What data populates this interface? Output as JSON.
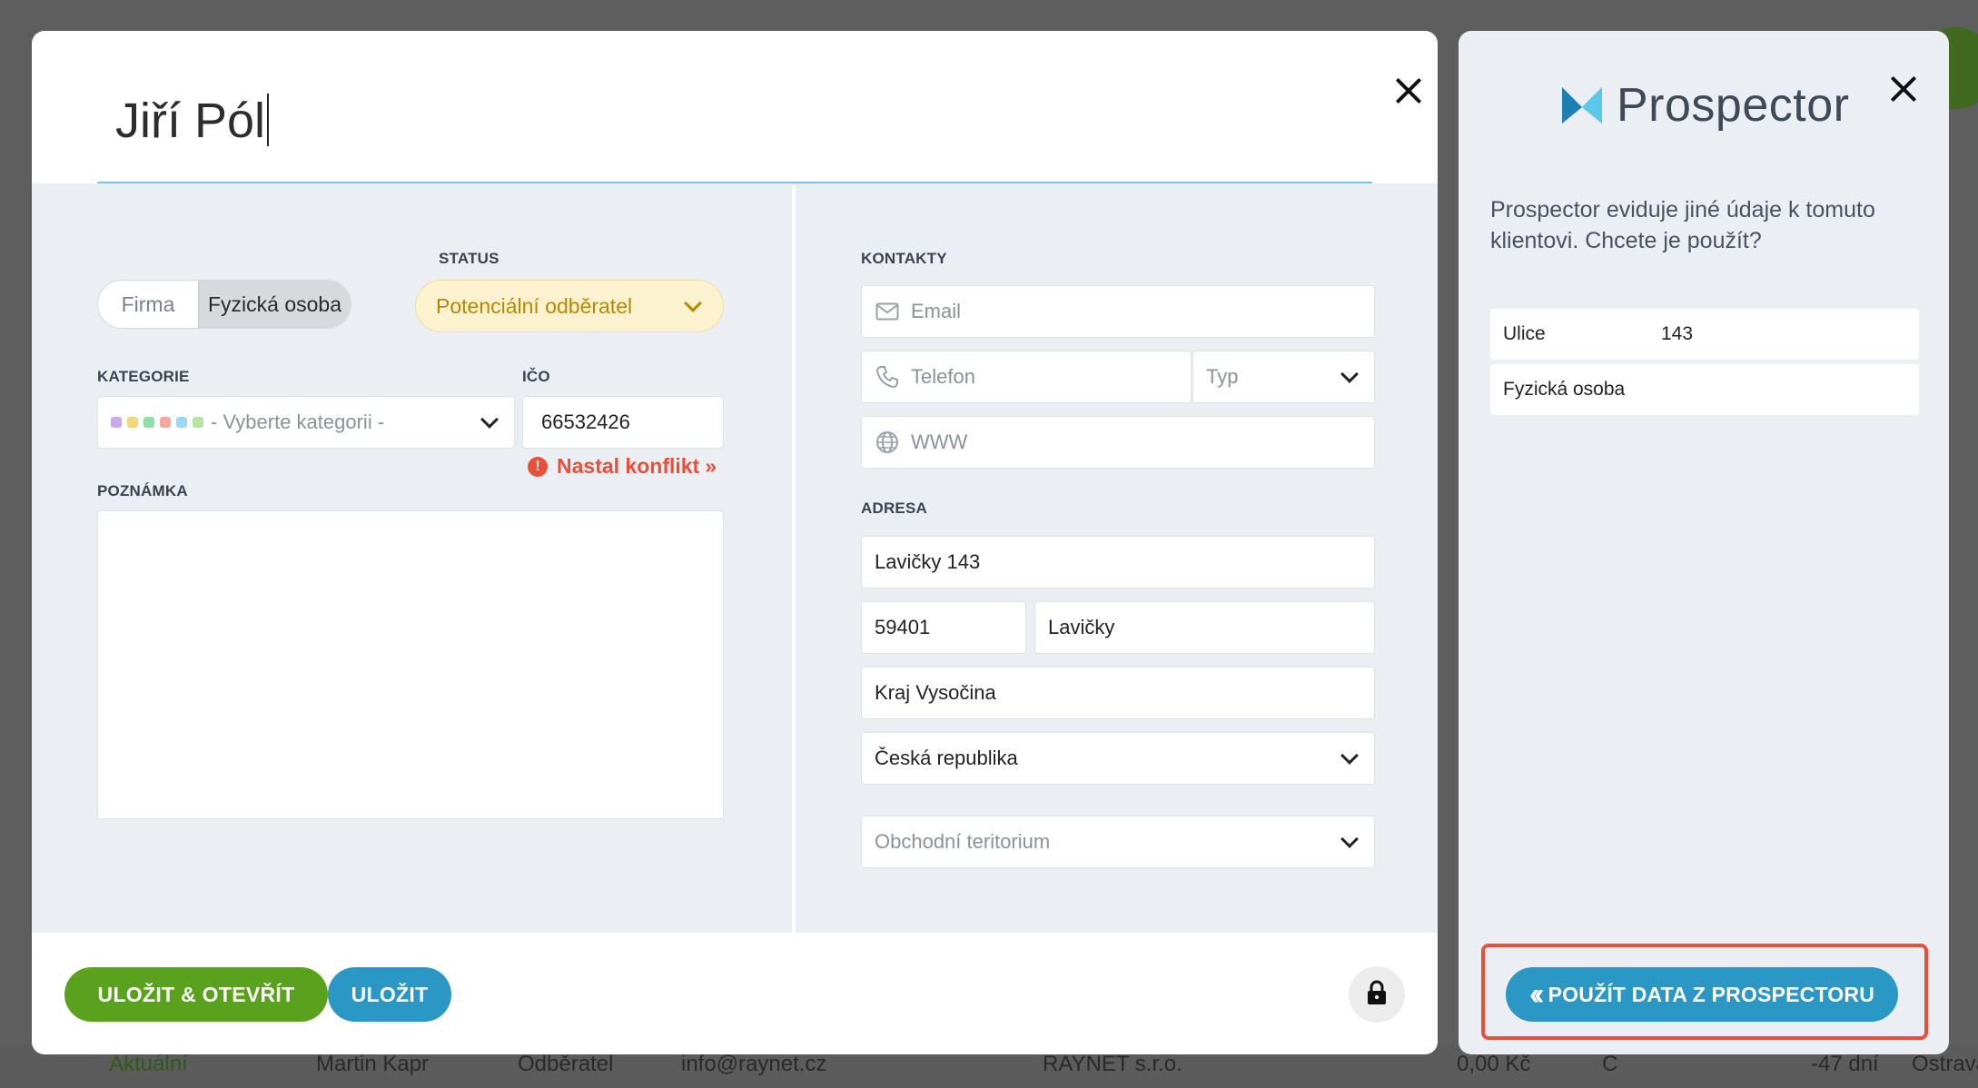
{
  "background": {
    "bottom_row": [
      "Aktuální",
      "Martin Kapr",
      "Odběratel",
      "info@raynet.cz",
      "RAYNET s.r.o.",
      "0,00 Kč",
      "C",
      "-47 dní",
      "Ostrava"
    ]
  },
  "modal": {
    "title": "Jiří Pól",
    "type_toggle": {
      "option_company": "Firma",
      "option_person": "Fyzická osoba",
      "selected": "Fyzická osoba"
    },
    "status": {
      "label": "STATUS",
      "value": "Potenciální odběratel"
    },
    "category": {
      "label": "KATEGORIE",
      "placeholder": "- Vyberte kategorii -",
      "dot_colors": [
        "#c9a8f0",
        "#f2d67a",
        "#8ee0a8",
        "#f5a7a0",
        "#9fd6f2",
        "#b7e4a0"
      ]
    },
    "ico": {
      "label": "IČO",
      "value": "66532426"
    },
    "conflict": {
      "text": "Nastal konflikt",
      "suffix": "»"
    },
    "note": {
      "label": "POZNÁMKA",
      "value": ""
    },
    "contacts": {
      "label": "KONTAKTY",
      "email_placeholder": "Email",
      "phone_placeholder": "Telefon",
      "phone_type_placeholder": "Typ",
      "www_placeholder": "WWW"
    },
    "address": {
      "label": "ADRESA",
      "street": "Lavičky 143",
      "zip": "59401",
      "city": "Lavičky",
      "region": "Kraj Vysočina",
      "country": "Česká republika",
      "territory_placeholder": "Obchodní teritorium"
    },
    "footer": {
      "save_open": "ULOŽIT & OTEVŘÍT",
      "save": "ULOŽIT"
    }
  },
  "prospector": {
    "brand": "Prospector",
    "message": "Prospector eviduje jiné údaje k tomuto klientovi. Chcete je použít?",
    "rows": [
      {
        "key": "Ulice",
        "value": "143"
      },
      {
        "key": "Fyzická osoba",
        "value": ""
      }
    ],
    "apply_button": "POUŽÍT DATA Z PROSPECTORU"
  },
  "colors": {
    "accent_blue": "#2a97c4",
    "accent_green": "#5aa21e",
    "conflict_red": "#e8503a",
    "status_yellow_bg": "#fdf2cf"
  }
}
